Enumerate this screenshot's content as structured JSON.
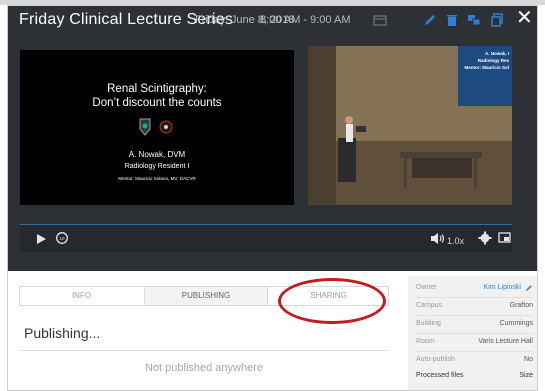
{
  "header": {
    "title": "Friday Clinical Lecture Series",
    "date": "Friday, June 8, 2018",
    "time_range": "8:00 AM - 9:00 AM"
  },
  "slide": {
    "title": "Renal Scintigraphy:\nDon’t discount the counts",
    "author": "A. Nowak, DVM",
    "role": "Radiology Resident I",
    "mentor": "Mentor: Mauricio Solano, MV, DACVR"
  },
  "camera_overlay": {
    "line1": "A. Nowak, I",
    "line2": "Radiology Res",
    "line3": "Mentor: Mauricio Sol"
  },
  "player": {
    "playback_rate": "1.0x",
    "progress": 1.0
  },
  "tabs": {
    "info": "INFO",
    "publishing": "PUBLISHING",
    "sharing": "SHARING"
  },
  "publishing": {
    "title": "Publishing...",
    "empty_message": "Not published anywhere"
  },
  "meta": {
    "owner_label": "Owner",
    "owner_value": "Kim Lipinski",
    "campus_label": "Campus",
    "campus_value": "Grafton",
    "building_label": "Building",
    "building_value": "Cummings",
    "room_label": "Room",
    "room_value": "Varis Lecture Hall",
    "autopublish_label": "Auto-publish",
    "autopublish_value": "No",
    "files_label": "Processed files",
    "size_label": "Size"
  },
  "colors": {
    "header_bg": "#2d3034",
    "accent": "#2f80d1",
    "highlight": "#c21b22"
  }
}
